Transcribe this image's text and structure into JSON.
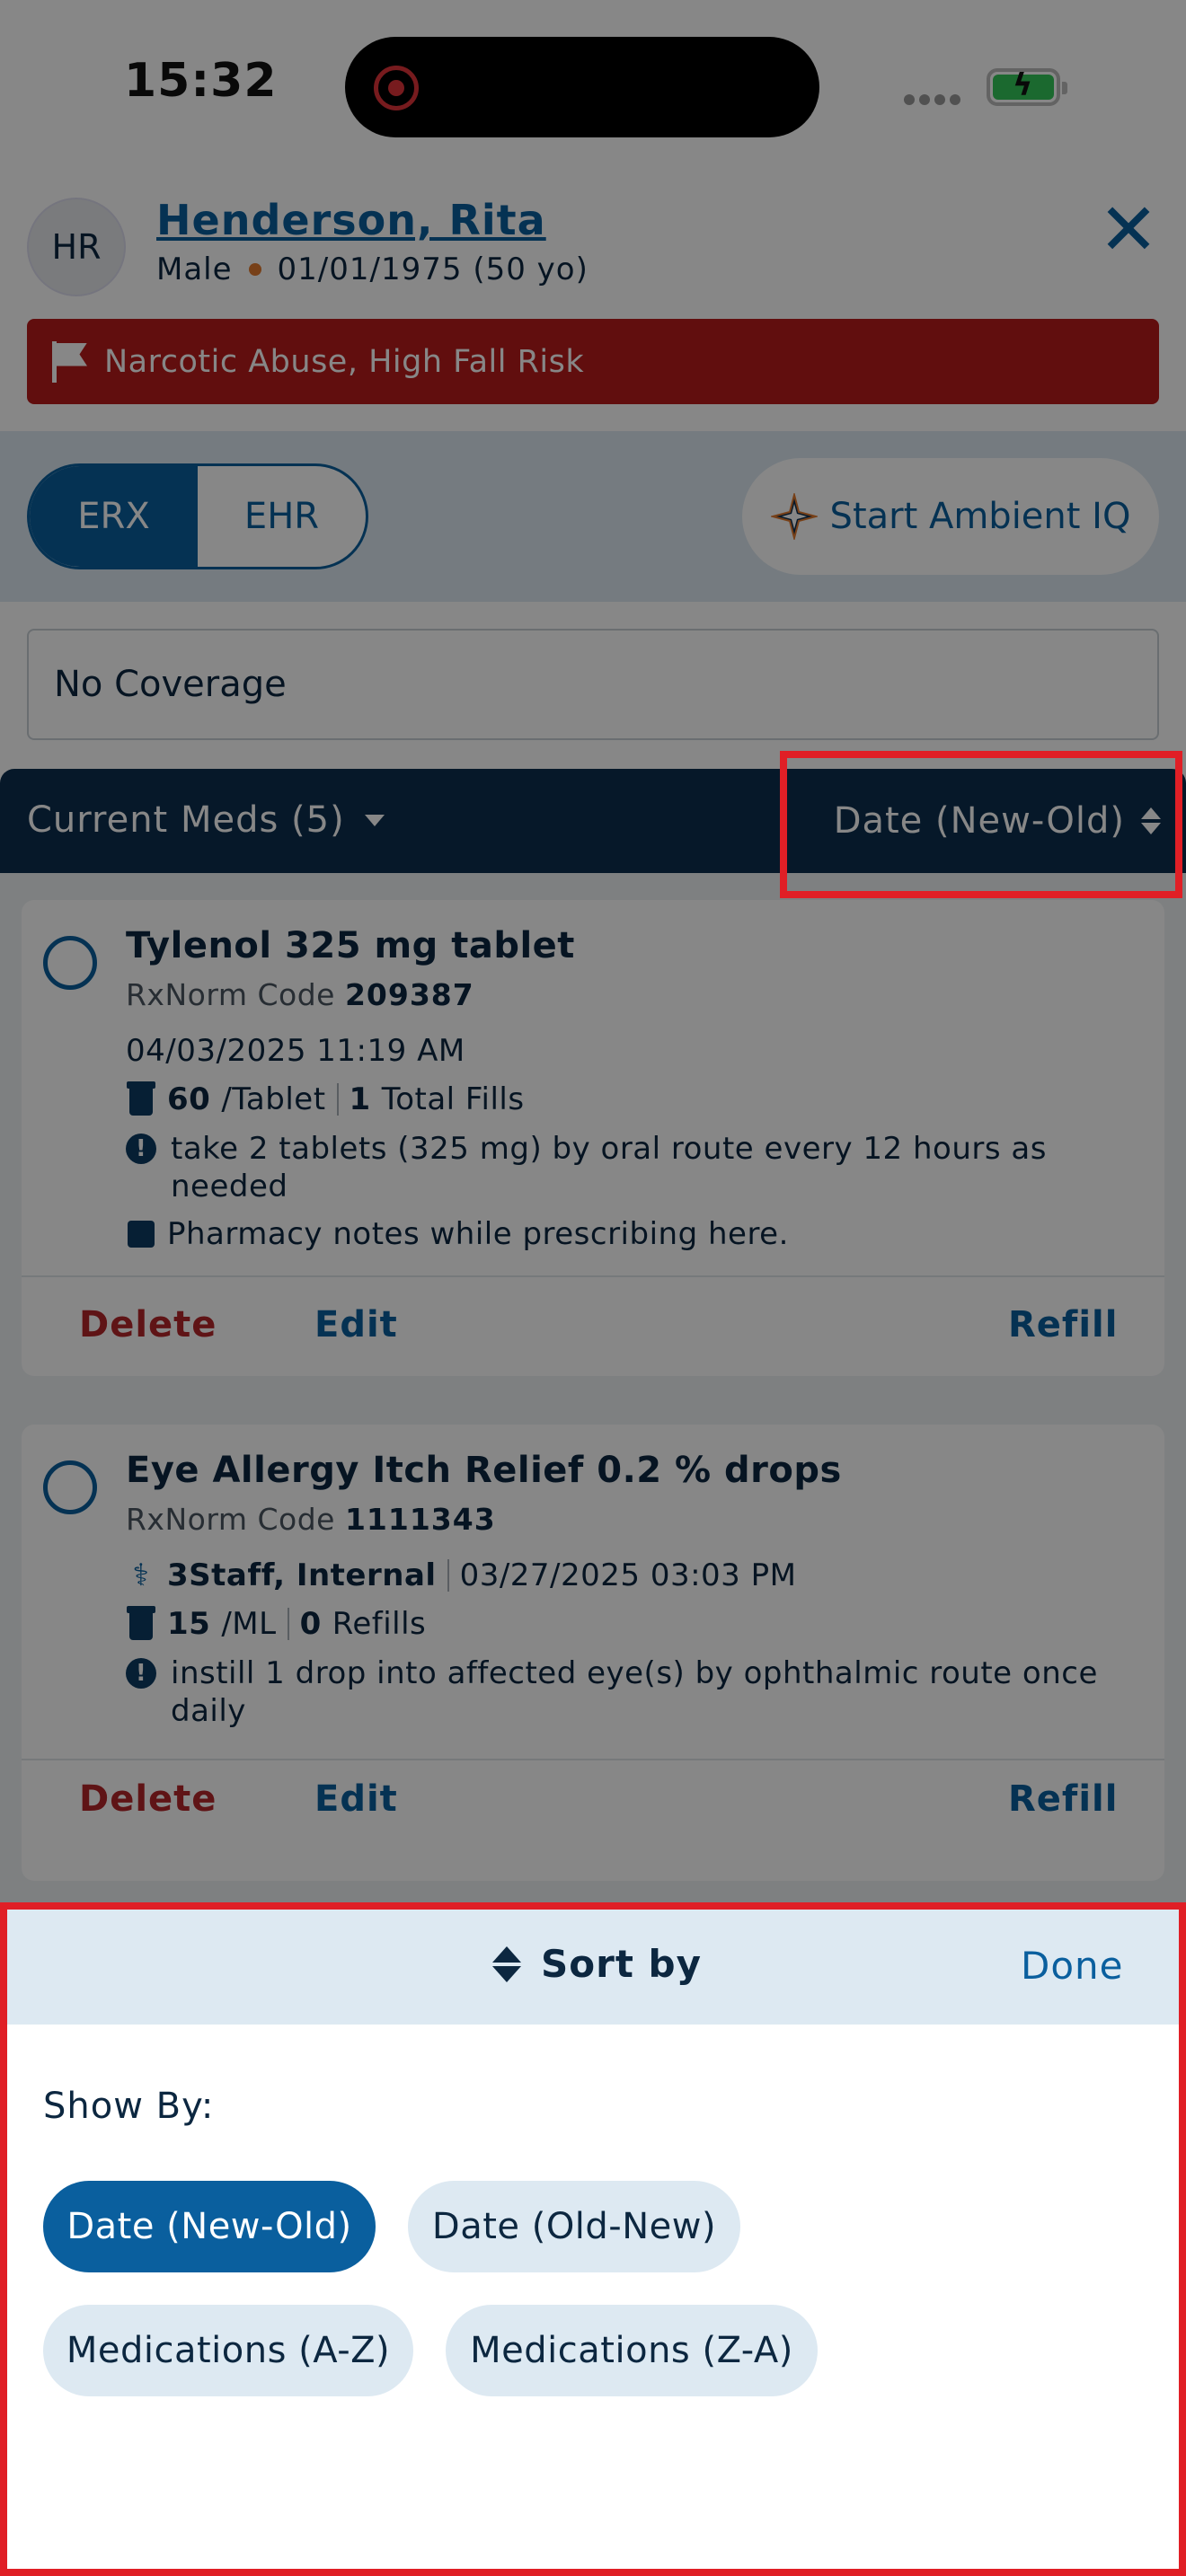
{
  "status_bar": {
    "time": "15:32"
  },
  "patient": {
    "initials": "HR",
    "name": "Henderson, Rita",
    "sex": "Male",
    "dob": "01/01/1975 (50 yo)",
    "alert": "Narcotic Abuse, High Fall Risk"
  },
  "mode_toggle": {
    "option_1": "ERX",
    "option_2": "EHR",
    "selected": "ERX"
  },
  "ambient_button": {
    "label": "Start Ambient IQ"
  },
  "coverage": {
    "label": "No Coverage"
  },
  "meds_header": {
    "title": "Current Meds (5)",
    "sort_label": "Date (New-Old)"
  },
  "medications": [
    {
      "name": "Tylenol 325 mg tablet",
      "rxnorm_label": "RxNorm Code",
      "rxnorm_code": "209387",
      "datetime": "04/03/2025 11:19 AM",
      "qty": "60",
      "unit": "/Tablet",
      "fills_count": "1",
      "fills_label": "Total Fills",
      "instructions": "take 2 tablets (325 mg) by oral route every 12 hours as needed",
      "notes": "Pharmacy notes while prescribing here.",
      "actions": {
        "delete": "Delete",
        "edit": "Edit",
        "refill": "Refill"
      }
    },
    {
      "name": "Eye Allergy Itch Relief 0.2 % drops",
      "rxnorm_label": "RxNorm Code",
      "rxnorm_code": "1111343",
      "prescriber": "3Staff, Internal",
      "datetime": "03/27/2025 03:03 PM",
      "qty": "15",
      "unit": "/ML",
      "fills_count": "0",
      "fills_label": "Refills",
      "instructions": "instill 1 drop into affected eye(s) by ophthalmic route once daily",
      "actions": {
        "delete": "Delete",
        "edit": "Edit",
        "refill": "Refill"
      }
    }
  ],
  "sort_sheet": {
    "title": "Sort by",
    "done": "Done",
    "show_by_label": "Show By:",
    "options": [
      "Date (New-Old)",
      "Date (Old-New)",
      "Medications (A-Z)",
      "Medications (Z-A)"
    ],
    "selected": "Date (New-Old)"
  },
  "colors": {
    "primary": "#0a5f9e",
    "navy": "#0c2f4e",
    "alert": "#b81c1c",
    "delete": "#b3262a",
    "highlight": "#e01f26"
  }
}
